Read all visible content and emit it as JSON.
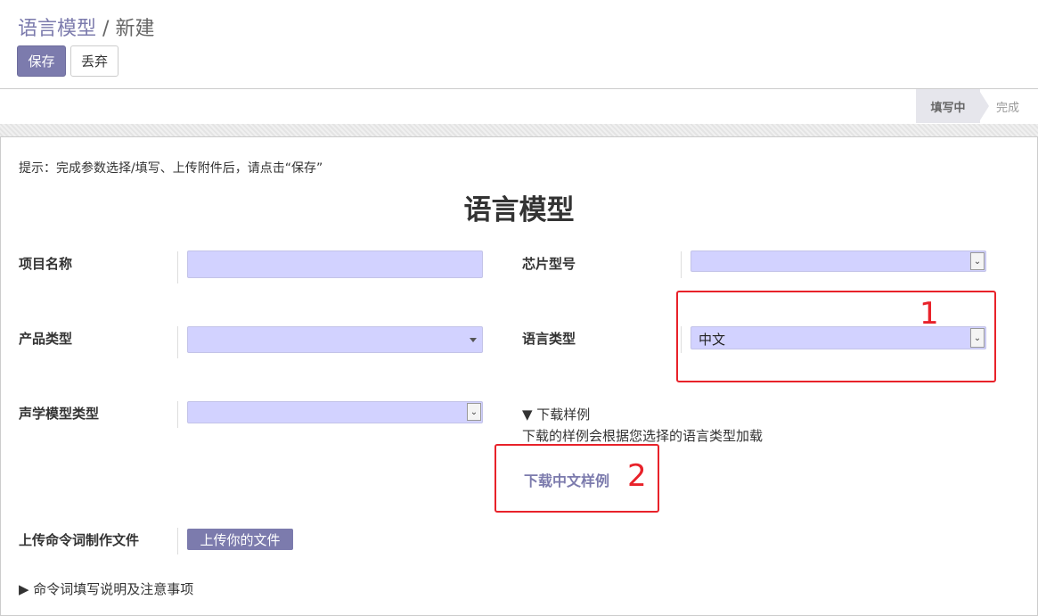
{
  "breadcrumb": {
    "parent": "语言模型",
    "separator": "/",
    "current": "新建"
  },
  "toolbar": {
    "save_label": "保存",
    "discard_label": "丢弃"
  },
  "statusbar": {
    "active": "填写中",
    "next": "完成"
  },
  "form": {
    "hint": "提示：完成参数选择/填写、上传附件后，请点击“保存”",
    "title": "语言模型",
    "project_name_label": "项目名称",
    "project_name_value": "",
    "chip_model_label": "芯片型号",
    "chip_model_value": "",
    "product_type_label": "产品类型",
    "product_type_value": "",
    "language_type_label": "语言类型",
    "language_type_value": "中文",
    "acoustic_model_label": "声学模型类型",
    "acoustic_model_value": "",
    "download_sample_toggle": "▼ 下载样例",
    "download_sample_desc": "下载的样例会根据您选择的语言类型加载",
    "download_link": "下载中文样例",
    "upload_label": "上传命令词制作文件",
    "upload_button": "上传你的文件",
    "instructions_toggle": "▶ 命令词填写说明及注意事项"
  },
  "annotations": {
    "box1": "1",
    "box2": "2"
  },
  "colors": {
    "accent": "#7c7bad",
    "input_bg": "#d2d2ff",
    "annotation_red": "#e8222a"
  }
}
